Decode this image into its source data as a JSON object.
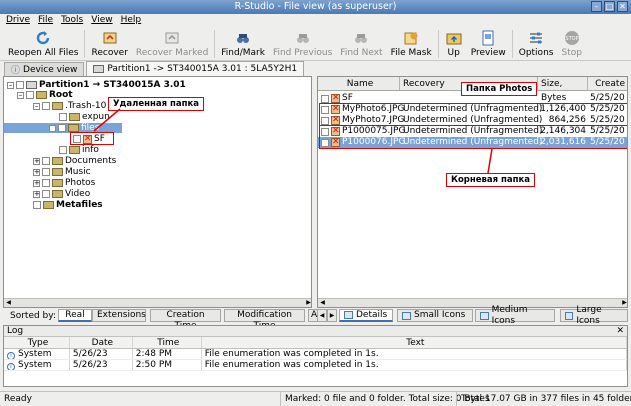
{
  "window": {
    "title": "R-Studio - File view (as superuser)"
  },
  "menu": [
    "Drive",
    "File",
    "Tools",
    "View",
    "Help"
  ],
  "toolbar": {
    "reopen": "Reopen All Files",
    "recover": "Recover",
    "recover_marked": "Recover Marked",
    "find_mark": "Find/Mark",
    "find_prev": "Find Previous",
    "find_next": "Find Next",
    "file_mask": "File Mask",
    "up": "Up",
    "preview": "Preview",
    "options": "Options",
    "stop": "Stop"
  },
  "tabs": {
    "device_view": "Device view",
    "partition": "Partition1 -> ST340015A 3.01 : 5LA5Y2H1"
  },
  "tree": {
    "partition": "Partition1 → ST340015A 3.01",
    "root": "Root",
    "trash": ".Trash-10",
    "expunged": "expun",
    "files": "files",
    "sf": "SF",
    "info": "info",
    "documents": "Documents",
    "music": "Music",
    "photos": "Photos",
    "video": "Video",
    "metafiles": "Metafiles"
  },
  "file_list": {
    "headers": {
      "name": "Name",
      "recovery": "Recovery",
      "size": "Size, Bytes",
      "created": "Create"
    },
    "rows": [
      {
        "name": "SF",
        "recovery": "",
        "size": "",
        "date": "5/25/20"
      },
      {
        "name": "MyPhoto6.JPG",
        "recovery": "Undetermined (Unfragmented)",
        "size": "1,126,400",
        "date": "5/25/20"
      },
      {
        "name": "MyPhoto7.JPG",
        "recovery": "Undetermined (Unfragmented)",
        "size": "864,256",
        "date": "5/25/20"
      },
      {
        "name": "P1000075.JPG",
        "recovery": "Undetermined (Unfragmented)",
        "size": "2,146,304",
        "date": "5/25/20"
      },
      {
        "name": "P1000076.JPG",
        "recovery": "Undetermined (Unfragmented)",
        "size": "2,031,616",
        "date": "5/25/20"
      }
    ]
  },
  "annotations": {
    "deleted_folder": "Удаленная папка",
    "photos_folder": "Папка Photos",
    "root_folder": "Корневая папка"
  },
  "sort": {
    "label": "Sorted by:",
    "tabs": [
      "Real",
      "Extensions",
      "Creation Time",
      "Modification Time",
      "Acce"
    ]
  },
  "view_tabs": [
    "Details",
    "Small Icons",
    "Medium Icons",
    "Large Icons"
  ],
  "log": {
    "title": "Log",
    "headers": {
      "type": "Type",
      "date": "Date",
      "time": "Time",
      "text": "Text"
    },
    "rows": [
      {
        "type": "System",
        "date": "5/26/23",
        "time": "2:48 PM",
        "text": "File enumeration was completed in 1s."
      },
      {
        "type": "System",
        "date": "5/26/23",
        "time": "2:50 PM",
        "text": "File enumeration was completed in 1s."
      }
    ]
  },
  "status": {
    "ready": "Ready",
    "marked": "Marked: 0 file and 0 folder. Total size: 0 Bytes",
    "total": "Total 17.07 GB in 377 files in 45 folders"
  }
}
